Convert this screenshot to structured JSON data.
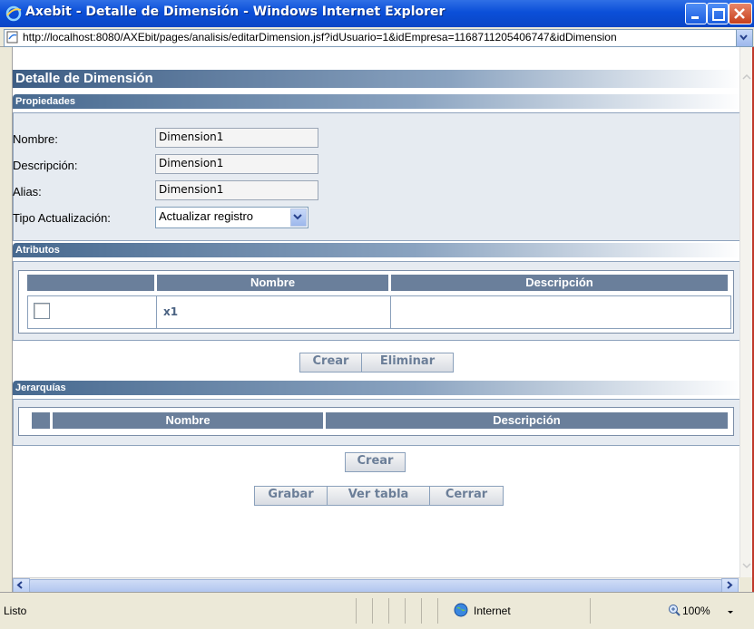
{
  "window": {
    "title": "Axebit - Detalle de Dimensión - Windows Internet Explorer"
  },
  "address": {
    "url": "http://localhost:8080/AXEbit/pages/analisis/editarDimension.jsf?idUsuario=1&idEmpresa=1168711205406747&idDimension"
  },
  "page": {
    "title": "Detalle de Dimensión"
  },
  "propiedades": {
    "header": "Propiedades",
    "nombre_label": "Nombre:",
    "nombre_value": "Dimension1",
    "descripcion_label": "Descripción:",
    "descripcion_value": "Dimension1",
    "alias_label": "Alias:",
    "alias_value": "Dimension1",
    "tipo_label": "Tipo Actualización:",
    "tipo_value": "Actualizar registro"
  },
  "atributos": {
    "header": "Atributos",
    "col_nombre": "Nombre",
    "col_descripcion": "Descripción",
    "rows": [
      {
        "nombre": "x1",
        "descripcion": ""
      }
    ],
    "crear": "Crear",
    "eliminar": "Eliminar"
  },
  "jerarquias": {
    "header": "Jerarquías",
    "col_nombre": "Nombre",
    "col_descripcion": "Descripción",
    "crear": "Crear"
  },
  "actions": {
    "grabar": "Grabar",
    "ver_tabla": "Ver tabla",
    "cerrar": "Cerrar"
  },
  "status": {
    "text": "Listo",
    "zone": "Internet",
    "zoom": "100%"
  },
  "colors": {
    "titlebar": "#0b4fd8",
    "header": "#47698f",
    "th": "#6a7f9b",
    "button_text": "#6b7e98"
  },
  "icons": [
    "ie-icon",
    "minimize-icon",
    "maximize-icon",
    "close-icon",
    "page-icon",
    "chevron-down-icon",
    "globe-icon",
    "zoom-icon"
  ]
}
